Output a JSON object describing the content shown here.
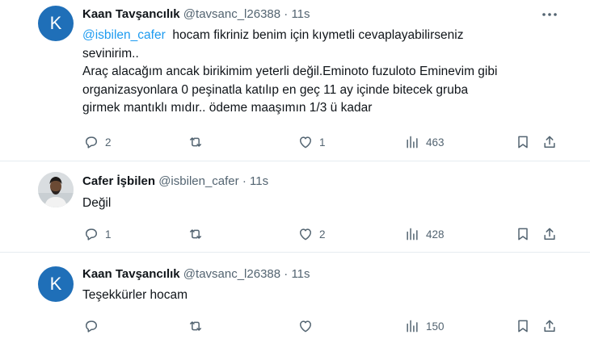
{
  "tweets": [
    {
      "avatar_letter": "K",
      "avatar_color": "#1f6fb8",
      "name": "Kaan Tavşancılık",
      "handle": "@tavsanc_l26388",
      "dot": "·",
      "time": "11s",
      "mention": "@isbilen_cafer",
      "line1_rest": "  hocam fikriniz benim için kıymetli cevaplayabilirseniz",
      "line2": "sevinirim..",
      "line3": "Araç alacağım  ancak birikimim yeterli değil.Eminoto fuzuloto Eminevim gibi",
      "line4": "organizasyonlara 0 peşinatla katılıp en geç 11 ay içinde bitecek gruba",
      "line5": "girmek mantıklı mıdır.. ödeme maaşımın 1/3 ü kadar",
      "replies": "2",
      "retweets": "",
      "likes": "1",
      "views": "463"
    },
    {
      "name": "Cafer İşbilen",
      "handle": "@isbilen_cafer",
      "dot": "·",
      "time": "11s",
      "text": "Değil",
      "replies": "1",
      "retweets": "",
      "likes": "2",
      "views": "428"
    },
    {
      "avatar_letter": "K",
      "avatar_color": "#1f6fb8",
      "name": "Kaan Tavşancılık",
      "handle": "@tavsanc_l26388",
      "dot": "·",
      "time": "11s",
      "text": "Teşekkürler hocam",
      "replies": "",
      "retweets": "",
      "likes": "",
      "views": "150"
    }
  ],
  "icons": {
    "reply": "reply-icon",
    "retweet": "retweet-icon",
    "like": "heart-icon",
    "views": "views-icon",
    "bookmark": "bookmark-icon",
    "share": "share-icon",
    "more": "more-icon"
  },
  "colors": {
    "mention": "#1d9bf0",
    "muted": "#536471",
    "text": "#0f1419"
  }
}
